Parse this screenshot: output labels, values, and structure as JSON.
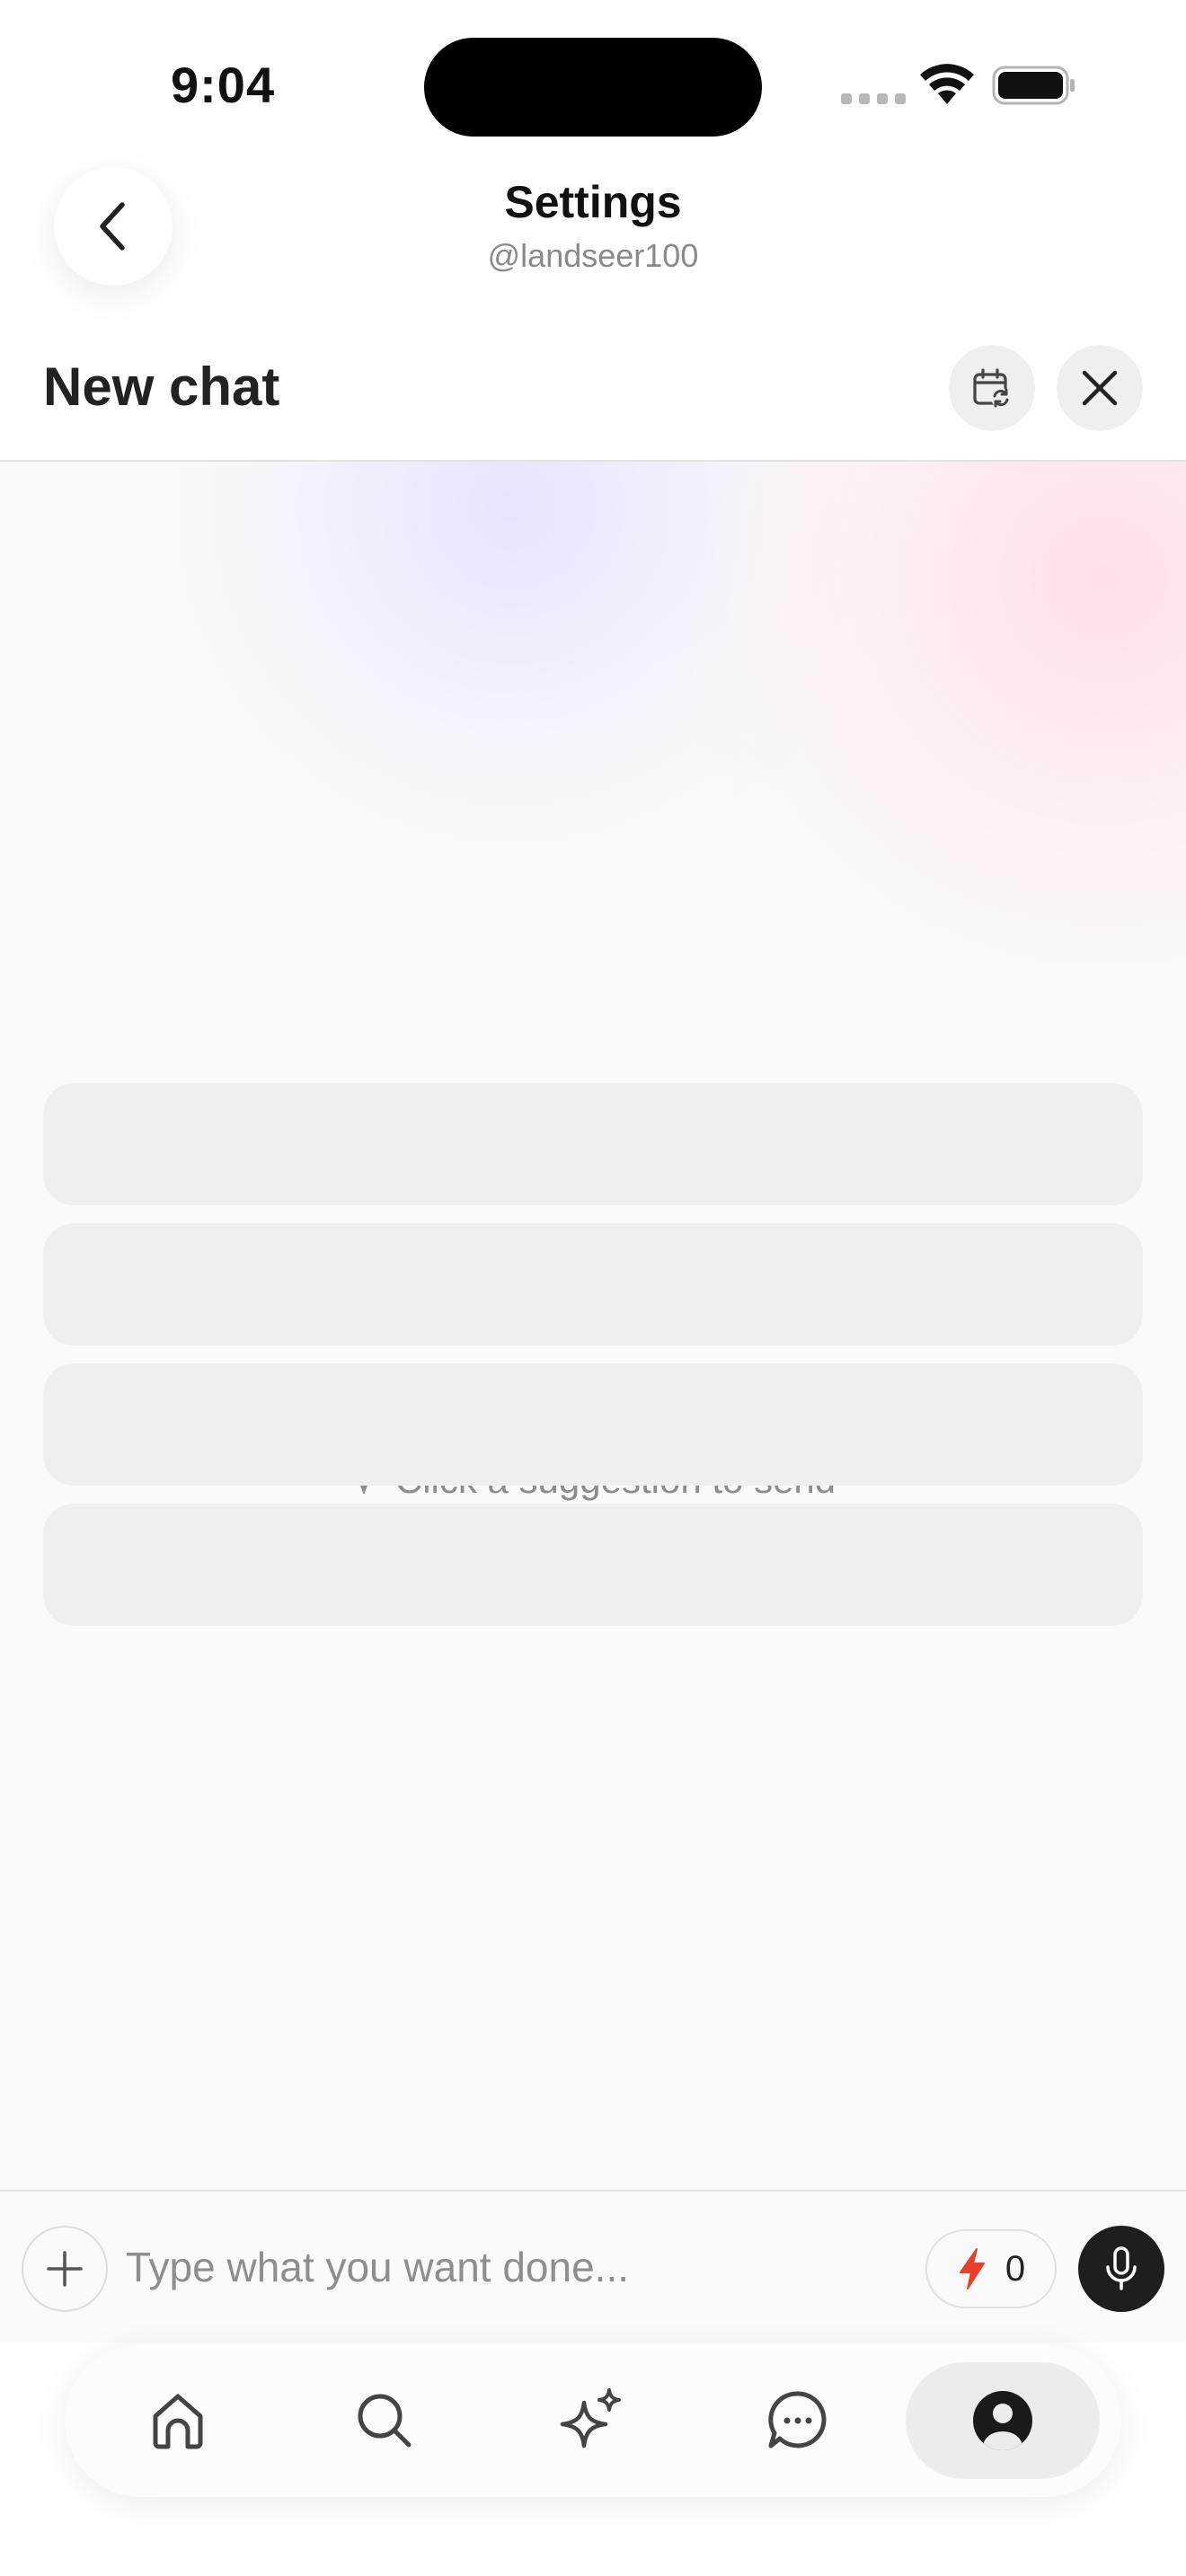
{
  "status_bar": {
    "time": "9:04"
  },
  "header": {
    "title": "Settings",
    "subtitle": "@landseer100"
  },
  "chat": {
    "title": "New chat"
  },
  "hint": {
    "text": "Click a suggestion to send"
  },
  "input": {
    "placeholder": "Type what you want done..."
  },
  "credits": {
    "count": "0"
  },
  "nav": {
    "items": [
      {
        "icon": "home-icon"
      },
      {
        "icon": "search-icon"
      },
      {
        "icon": "sparkle-icon"
      },
      {
        "icon": "chat-bubble-icon"
      },
      {
        "icon": "profile-icon",
        "active": true
      }
    ]
  },
  "colors": {
    "accent_credit": "#e8402b",
    "mic_bg": "#1e1e1e",
    "suggestion_bg": "#efefef"
  }
}
